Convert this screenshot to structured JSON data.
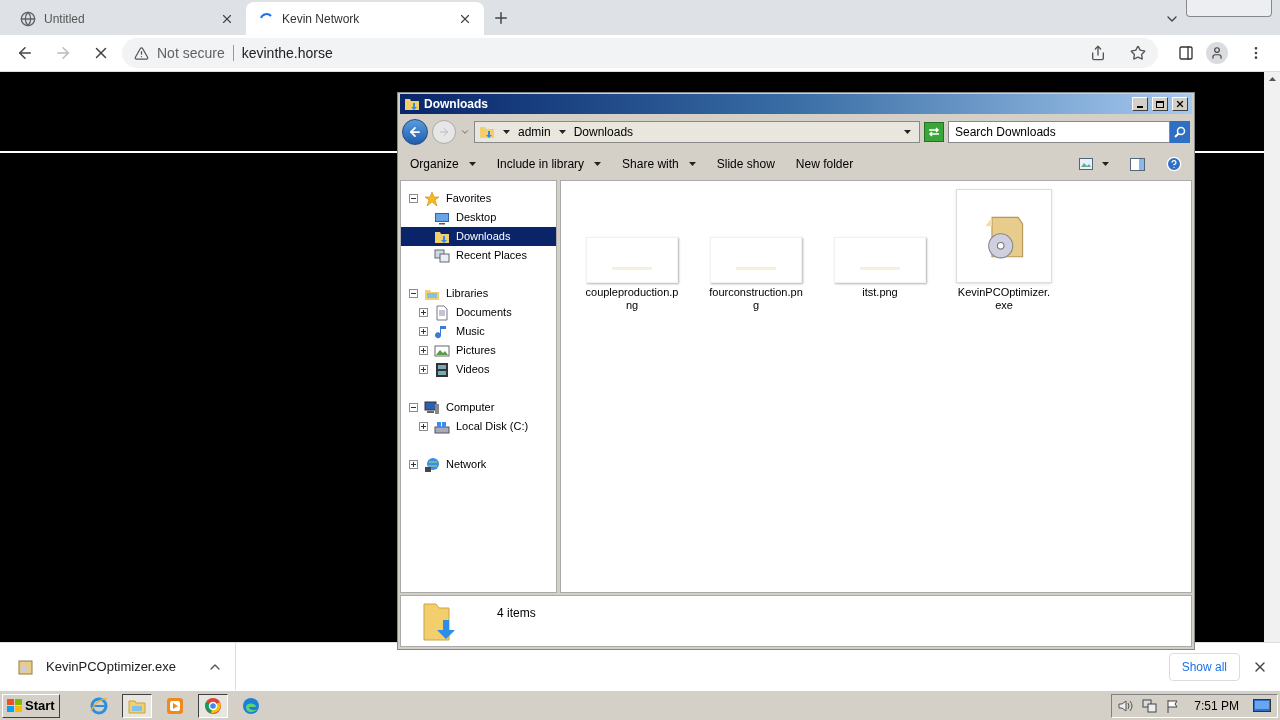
{
  "browser": {
    "tabs": [
      {
        "title": "Untitled",
        "selected": false,
        "loading": false
      },
      {
        "title": "Kevin Network",
        "selected": true,
        "loading": true
      }
    ],
    "security": "Not secure",
    "url": "kevinthe.horse"
  },
  "explorer": {
    "title": "Downloads",
    "breadcrumb": [
      "admin",
      "Downloads"
    ],
    "search": {
      "placeholder": "Search Downloads"
    },
    "commands": [
      {
        "label": "Organize",
        "menu": true
      },
      {
        "label": "Include in library",
        "menu": true
      },
      {
        "label": "Share with",
        "menu": true
      },
      {
        "label": "Slide show",
        "menu": false
      },
      {
        "label": "New folder",
        "menu": false
      }
    ],
    "nav": [
      {
        "label": "Favorites",
        "expanded": true,
        "selected": false,
        "children": [
          {
            "label": "Desktop",
            "selected": false
          },
          {
            "label": "Downloads",
            "selected": true
          },
          {
            "label": "Recent Places",
            "selected": false
          }
        ]
      },
      {
        "label": "Libraries",
        "expanded": true,
        "selected": false,
        "children": [
          {
            "label": "Documents",
            "expanded": false,
            "selected": false
          },
          {
            "label": "Music",
            "expanded": false,
            "selected": false
          },
          {
            "label": "Pictures",
            "expanded": false,
            "selected": false
          },
          {
            "label": "Videos",
            "expanded": false,
            "selected": false
          }
        ]
      },
      {
        "label": "Computer",
        "expanded": true,
        "selected": false,
        "children": [
          {
            "label": "Local Disk (C:)",
            "expanded": false,
            "selected": false
          }
        ]
      },
      {
        "label": "Network",
        "expanded": false,
        "selected": false
      }
    ],
    "files": [
      {
        "name": "coupleproduction.png"
      },
      {
        "name": "fourconstruction.png"
      },
      {
        "name": "itst.png"
      },
      {
        "name": "KevinPCOptimizer.exe",
        "kind": "exe"
      }
    ],
    "status": "4 items"
  },
  "download_bar": {
    "file": "KevinPCOptimizer.exe",
    "show_all": "Show all"
  },
  "taskbar": {
    "start": "Start",
    "apps": [
      {
        "kind": "ie",
        "selected": false
      },
      {
        "kind": "explorer",
        "selected": true
      },
      {
        "kind": "media",
        "selected": false
      },
      {
        "kind": "chrome",
        "selected": true
      },
      {
        "kind": "edge",
        "selected": false
      }
    ],
    "clock": "7:51 PM"
  }
}
